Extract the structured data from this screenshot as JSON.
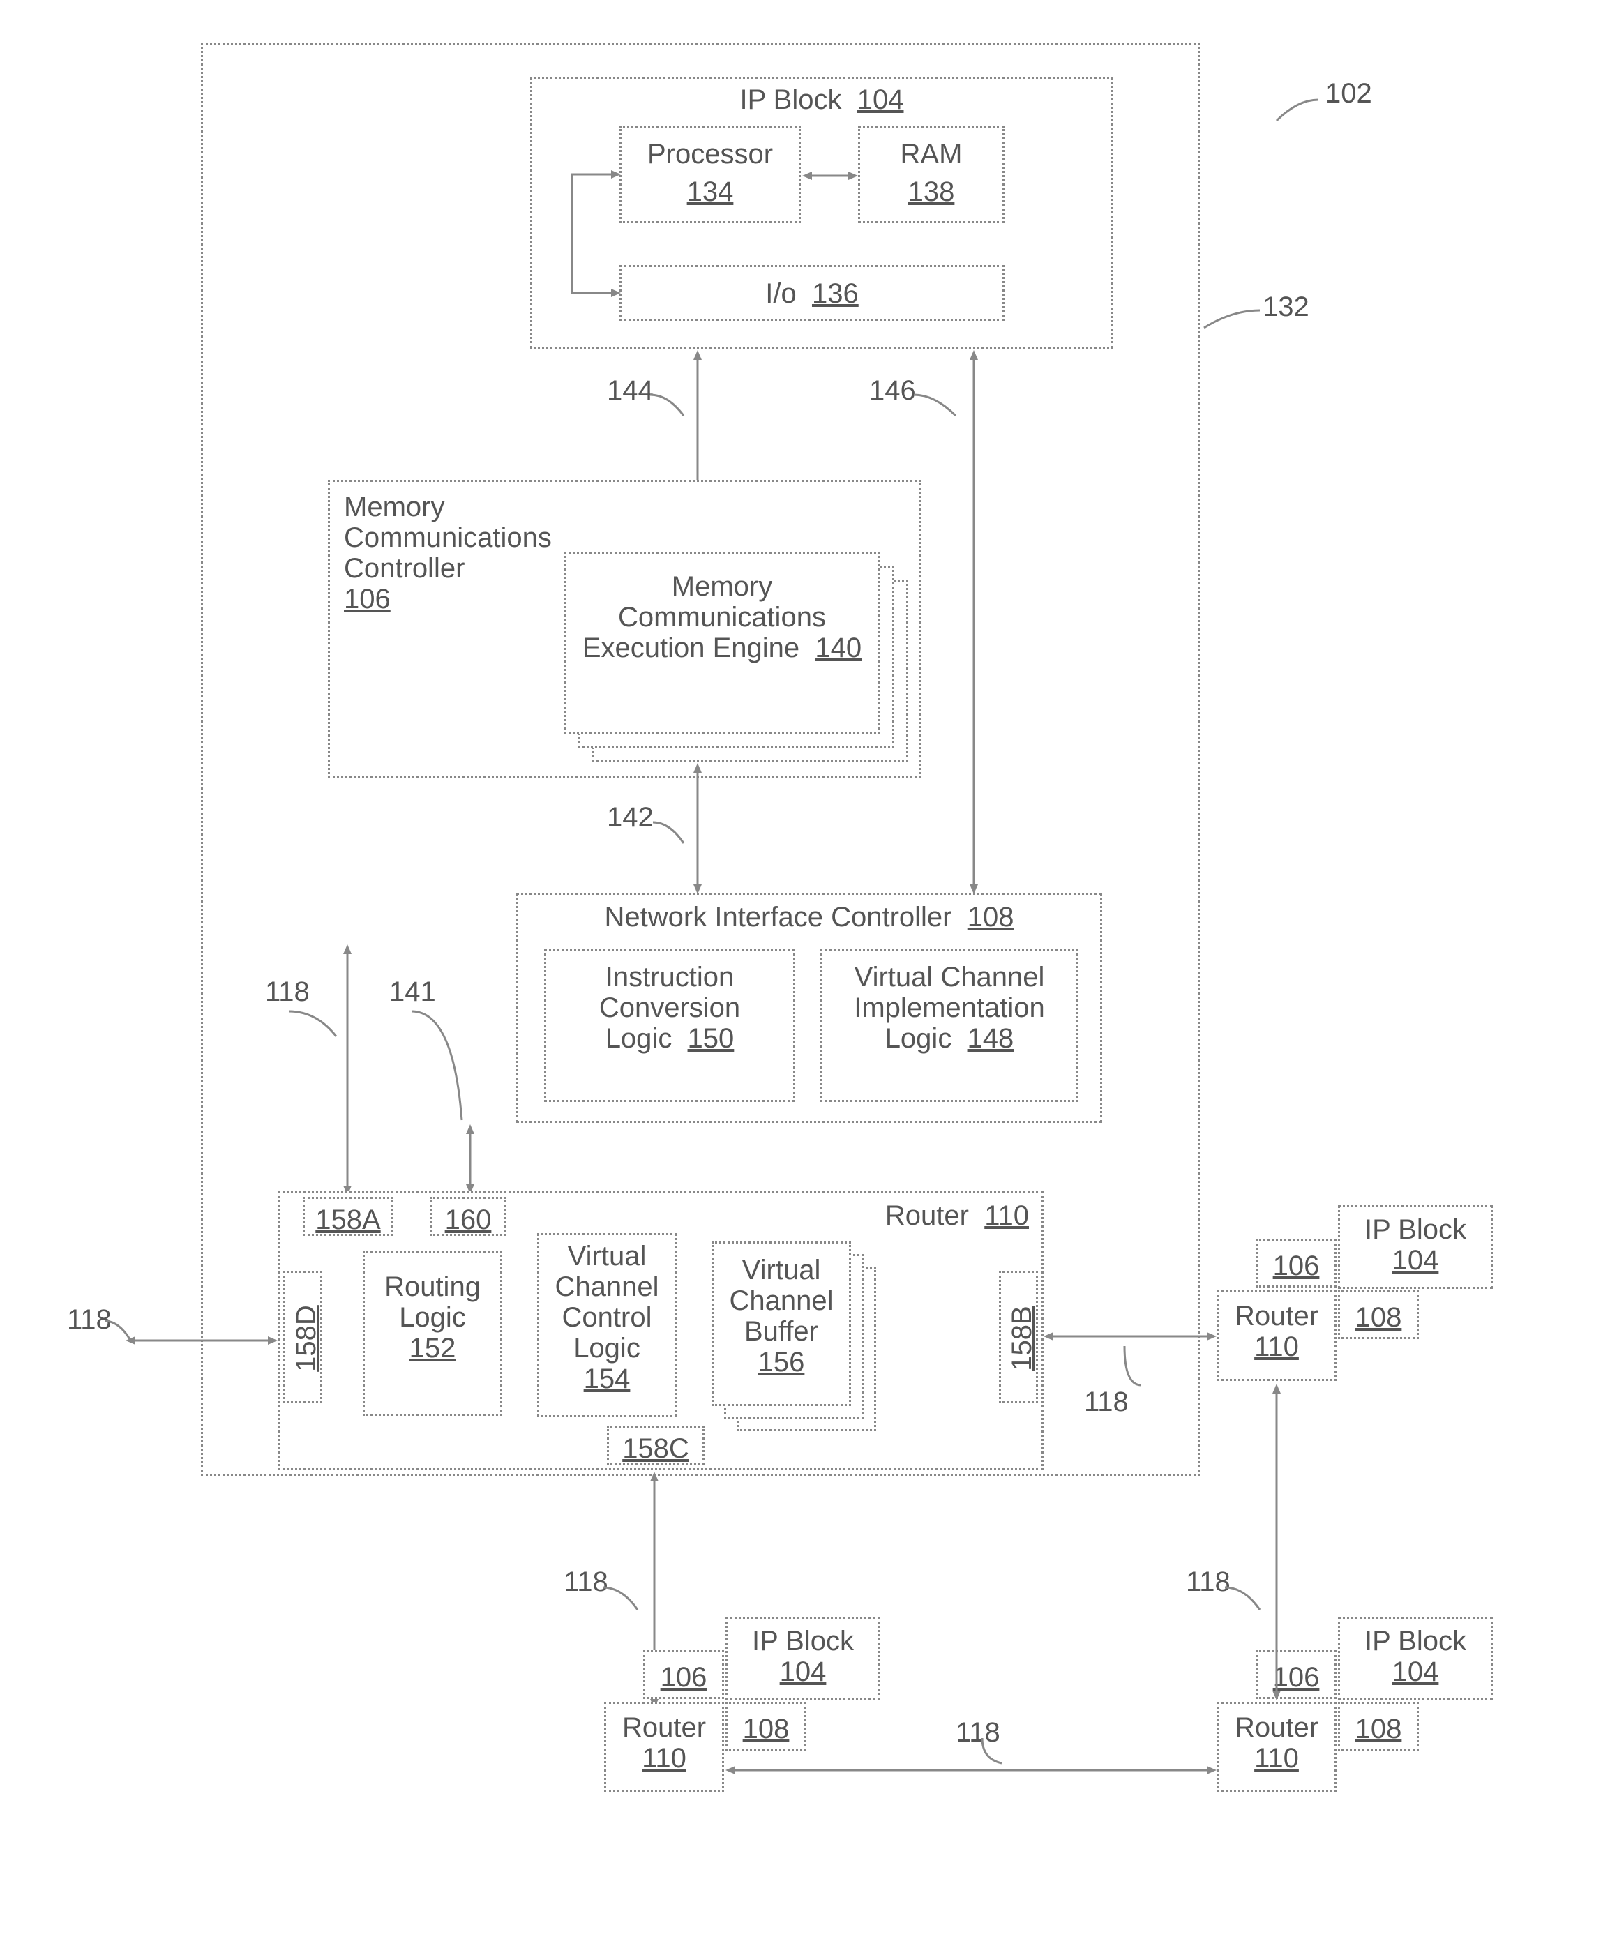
{
  "top": {
    "ref102": "102",
    "ref132": "132"
  },
  "ipblock": {
    "title": "IP Block",
    "num": "104",
    "processor": "Processor",
    "procNum": "134",
    "ram": "RAM",
    "ramNum": "138",
    "io": "I/o",
    "ioNum": "136"
  },
  "arrows": {
    "a144": "144",
    "a146": "146",
    "a142": "142",
    "a141": "141",
    "a118": "118"
  },
  "mcc": {
    "title1": "Memory",
    "title2": "Communications",
    "title3": "Controller",
    "num": "106",
    "engTitle1": "Memory",
    "engTitle2": "Communications",
    "engTitle3": "Execution Engine",
    "engNum": "140"
  },
  "nic": {
    "title": "Network Interface Controller",
    "num": "108",
    "icl1": "Instruction",
    "icl2": "Conversion",
    "icl3": "Logic",
    "iclNum": "150",
    "vci1": "Virtual Channel",
    "vci2": "Implementation",
    "vci3": "Logic",
    "vciNum": "148"
  },
  "router": {
    "title": "Router",
    "num": "110",
    "p158A": "158A",
    "p160": "160",
    "p158B": "158B",
    "p158C": "158C",
    "p158D": "158D",
    "rl1": "Routing",
    "rl2": "Logic",
    "rlNum": "152",
    "vccl1": "Virtual",
    "vccl2": "Channel",
    "vccl3": "Control",
    "vccl4": "Logic",
    "vcclNum": "154",
    "vcb1": "Virtual",
    "vcb2": "Channel",
    "vcb3": "Buffer",
    "vcbNum": "156"
  },
  "ext": {
    "ipblock": "IP Block",
    "ip104": "104",
    "p106": "106",
    "p108": "108",
    "router": "Router",
    "r110": "110"
  }
}
